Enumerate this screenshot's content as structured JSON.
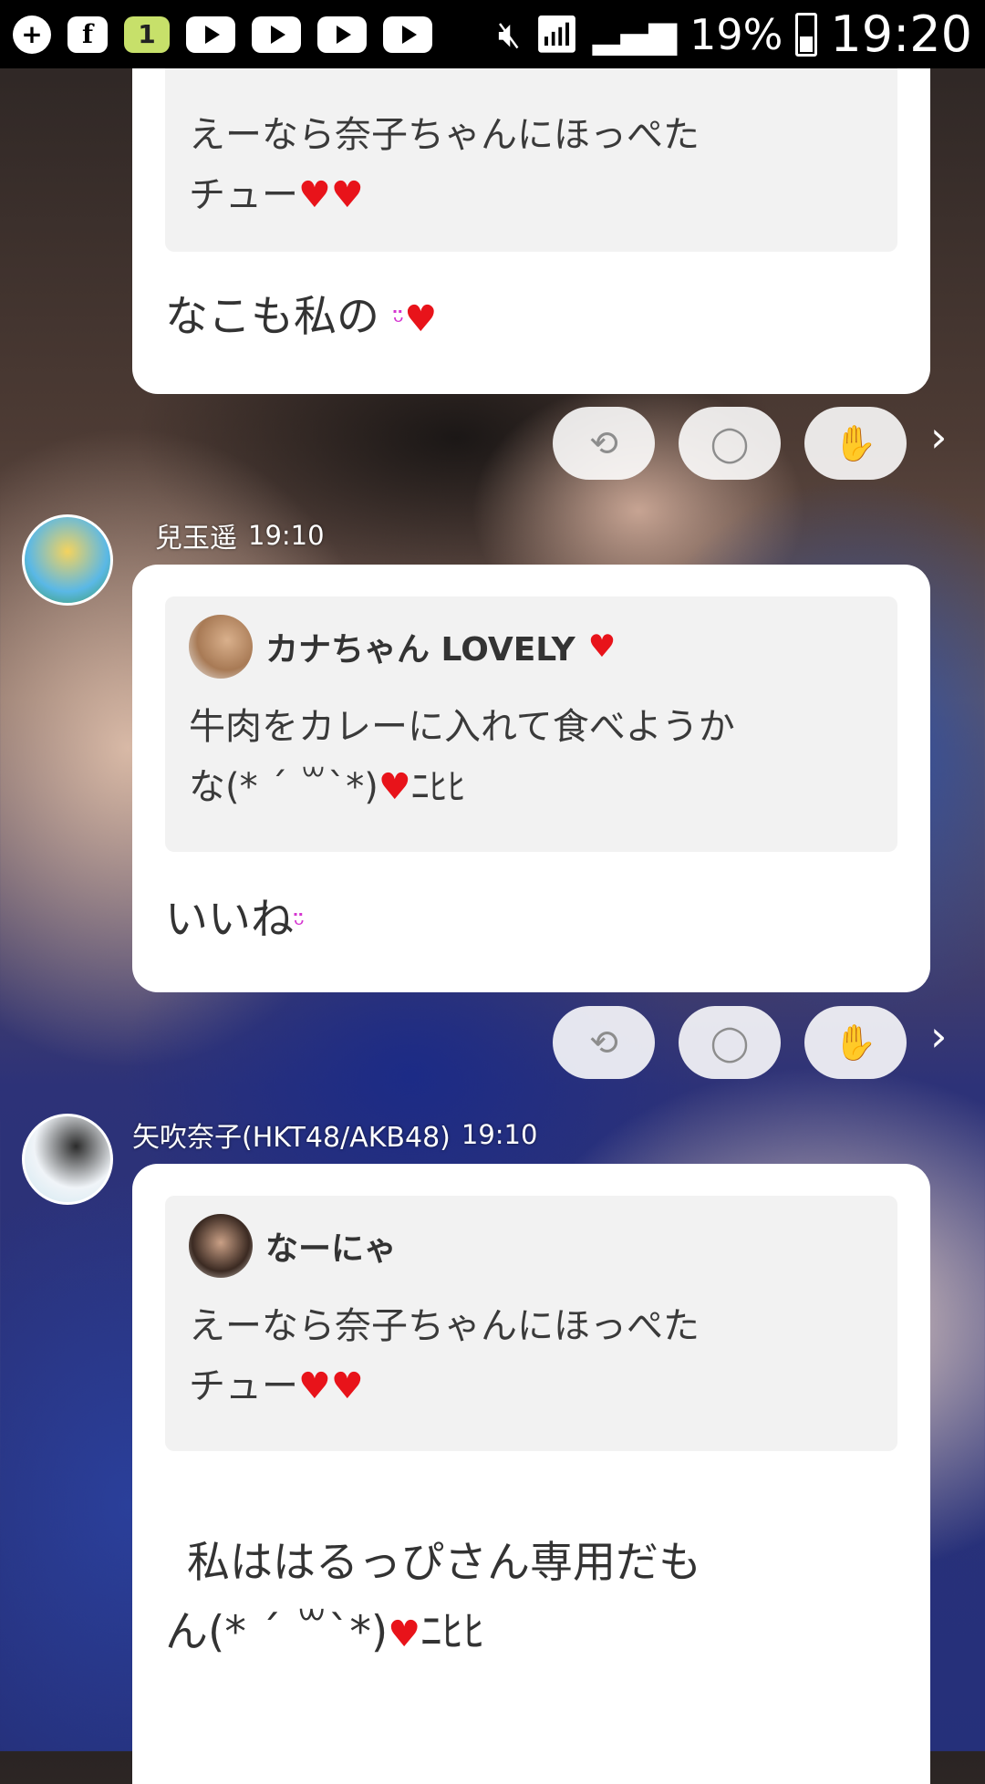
{
  "status_bar": {
    "battery": "19%",
    "time": "19:20",
    "notif_count": "1",
    "fb": "f"
  },
  "icons": {
    "repost": "⟲",
    "comment": "◯",
    "clap": "✋",
    "chevron": "›",
    "heart": "♥",
    "smile": "ᵕ̈"
  },
  "posts": [
    {
      "quote_text_1": "えーなら奈子ちゃんにほっぺた",
      "quote_text_2": "チュー",
      "message": "なこも私の"
    },
    {
      "sender": "兒玉遥",
      "time": "19:10",
      "quote_author": "カナちゃん LOVELY",
      "quote_text_1": "牛肉をカレーに入れて食べようか",
      "quote_text_2": "な(* ´ ꒳`*)",
      "quote_text_2_suffix": "ﾆﾋﾋ",
      "message": "いいね"
    },
    {
      "sender": "矢吹奈子(HKT48/AKB48)",
      "time": "19:10",
      "quote_author": "なーにゃ",
      "quote_text_1": "えーなら奈子ちゃんにほっぺた",
      "quote_text_2": "チュー",
      "message_1": "私ははるっぴさん専用だも",
      "message_2": "ん(* ´ ꒳`*)",
      "message_2_suffix": "ﾆﾋﾋ"
    }
  ],
  "colors": {
    "heart": "#e8131a",
    "smile": "#d535d0",
    "card": "#ffffff",
    "quote_bg": "#f2f2f2"
  }
}
